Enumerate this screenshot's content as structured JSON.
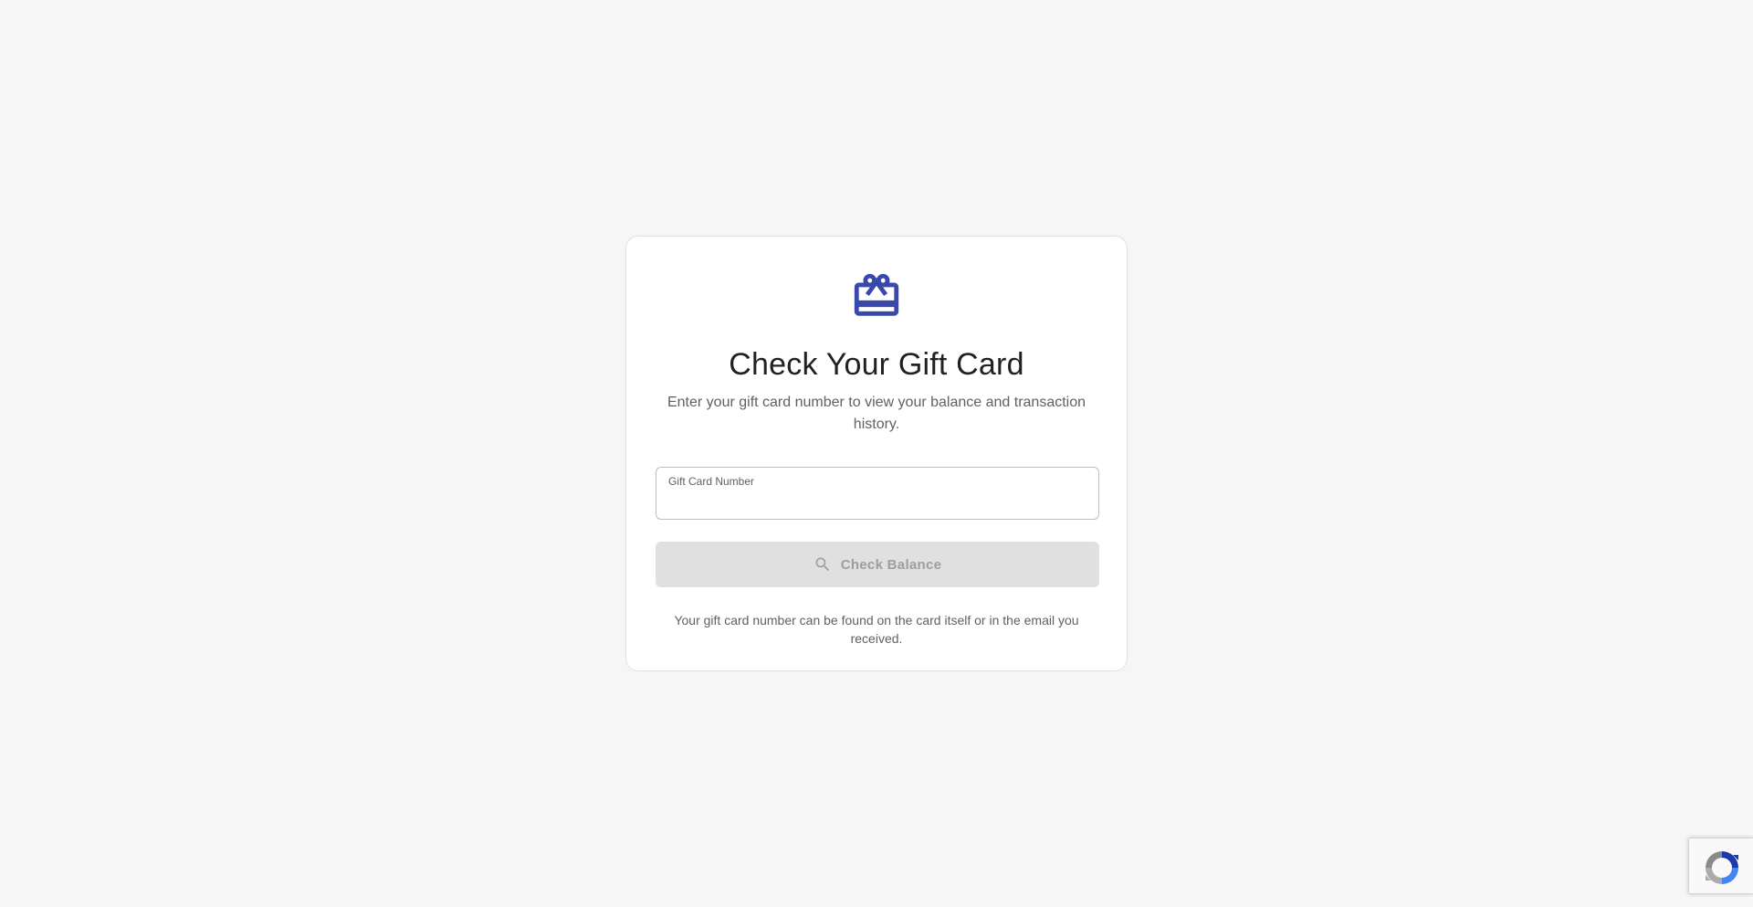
{
  "card": {
    "icon": "gift-card-icon",
    "title": "Check Your Gift Card",
    "subtitle": "Enter your gift card number to view your balance and transaction history.",
    "field": {
      "label": "Gift Card Number",
      "value": "",
      "placeholder": ""
    },
    "button": {
      "icon": "search-icon",
      "label": "Check Balance",
      "disabled": true
    },
    "hint": "Your gift card number can be found on the card itself or in the email you received."
  },
  "recaptcha": {
    "icon": "recaptcha-icon"
  },
  "colors": {
    "background": "#f6f6f6",
    "card_background": "#ffffff",
    "accent": "#3949ab",
    "button_disabled_bg": "#e0e0e0",
    "button_disabled_text": "#9e9e9e",
    "text_primary": "#212121",
    "text_secondary": "#616161"
  }
}
